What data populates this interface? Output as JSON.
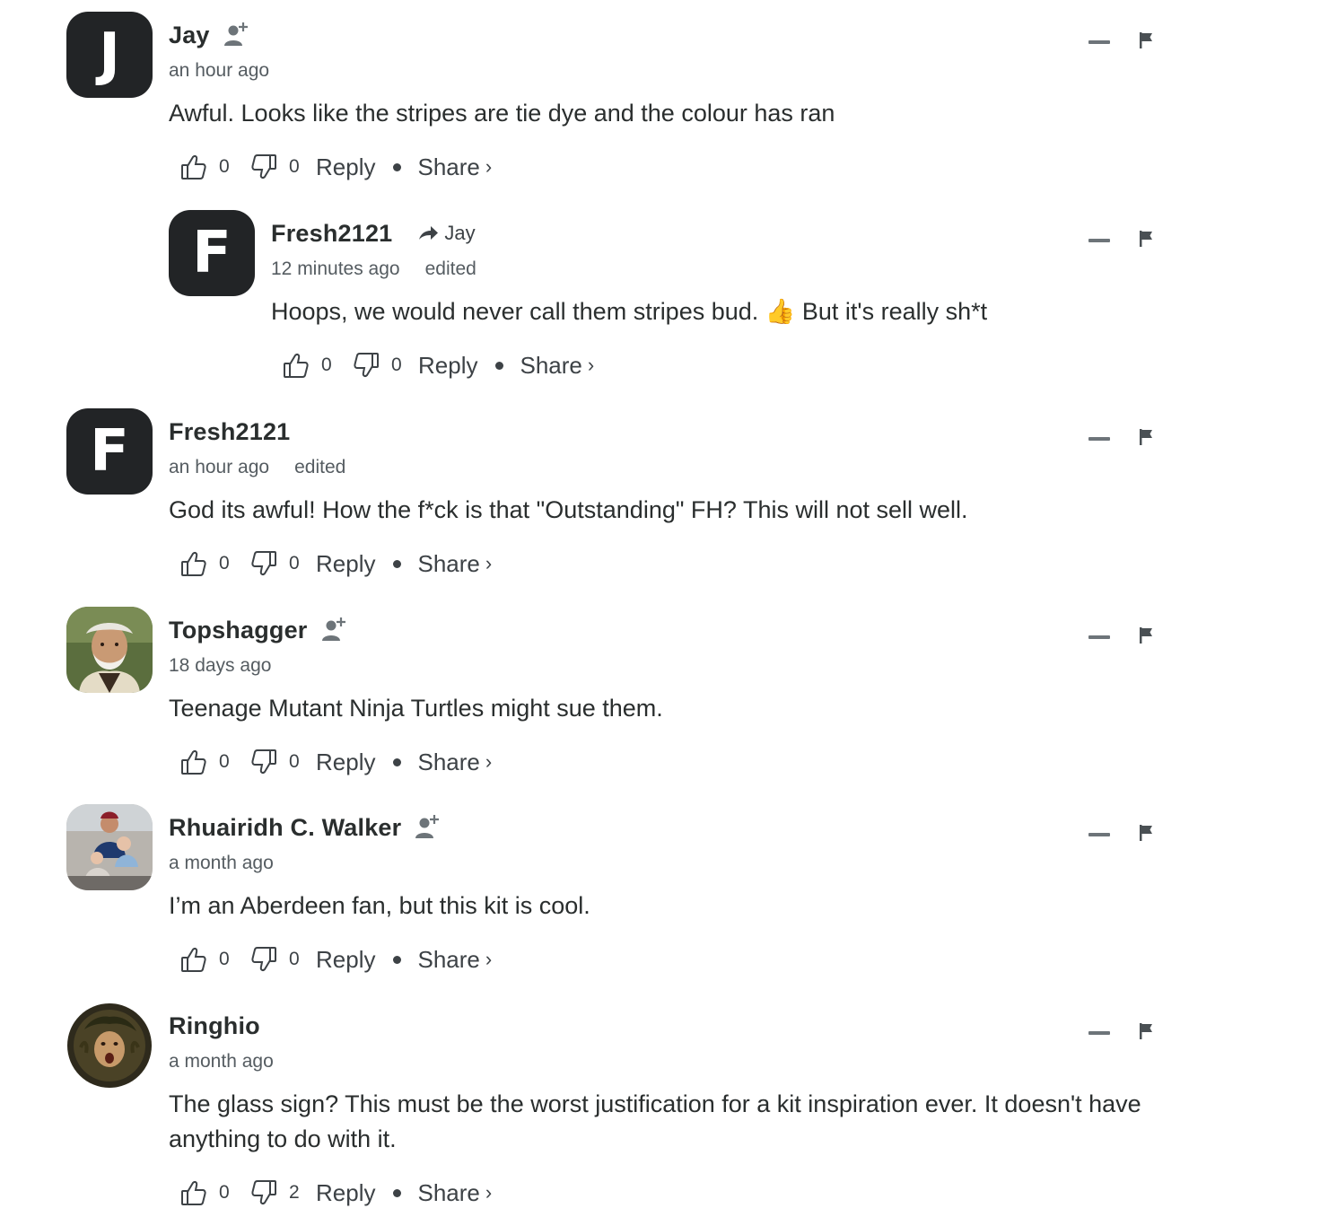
{
  "comments": [
    {
      "author": "Jay",
      "avatar_letter": "J",
      "avatar_type": "letter",
      "follow_icon": true,
      "time": "an hour ago",
      "edited": "",
      "text": "Awful. Looks like the stripes are tie dye and the colour has ran",
      "upvotes": "0",
      "downvotes": "0",
      "reply_label": "Reply",
      "share_label": "Share",
      "share_chevron": "›"
    },
    {
      "author": "Fresh2121",
      "avatar_letter": "F",
      "avatar_type": "letter",
      "follow_icon": false,
      "reply_to": "Jay",
      "time": "12 minutes ago",
      "edited": "edited",
      "text": "Hoops, we would never call them stripes bud. 👍 But it's really sh*t",
      "upvotes": "0",
      "downvotes": "0",
      "reply_label": "Reply",
      "share_label": "Share",
      "share_chevron": "›"
    },
    {
      "author": "Fresh2121",
      "avatar_letter": "F",
      "avatar_type": "letter",
      "follow_icon": false,
      "time": "an hour ago",
      "edited": "edited",
      "text": "God its awful! How the f*ck is that \"Outstanding\" FH? This will not sell well.",
      "upvotes": "0",
      "downvotes": "0",
      "reply_label": "Reply",
      "share_label": "Share",
      "share_chevron": "›"
    },
    {
      "author": "Topshagger",
      "avatar_type": "photo",
      "follow_icon": true,
      "time": "18 days ago",
      "edited": "",
      "text": "Teenage Mutant Ninja Turtles might sue them.",
      "upvotes": "0",
      "downvotes": "0",
      "reply_label": "Reply",
      "share_label": "Share",
      "share_chevron": "›"
    },
    {
      "author": "Rhuairidh C. Walker",
      "avatar_type": "photo",
      "follow_icon": true,
      "time": "a month ago",
      "edited": "",
      "text": "I’m an Aberdeen fan, but this kit is cool.",
      "upvotes": "0",
      "downvotes": "0",
      "reply_label": "Reply",
      "share_label": "Share",
      "share_chevron": "›"
    },
    {
      "author": "Ringhio",
      "avatar_type": "photo",
      "follow_icon": false,
      "time": "a month ago",
      "edited": "",
      "text": "The glass sign? This must be the worst justification for a kit inspiration ever. It doesn't have anything to do with it.",
      "upvotes": "0",
      "downvotes": "2",
      "reply_label": "Reply",
      "share_label": "Share",
      "share_chevron": "›"
    }
  ],
  "icons": {
    "upvote": "thumbs-up-icon",
    "downvote": "thumbs-down-icon",
    "follow": "follow-user-icon",
    "reply_arrow": "reply-arrow-icon",
    "minimize": "minimize-icon",
    "flag": "flag-icon"
  },
  "colors": {
    "text": "#2a2e2e",
    "muted": "#555c61",
    "avatar_bg": "#222426"
  }
}
